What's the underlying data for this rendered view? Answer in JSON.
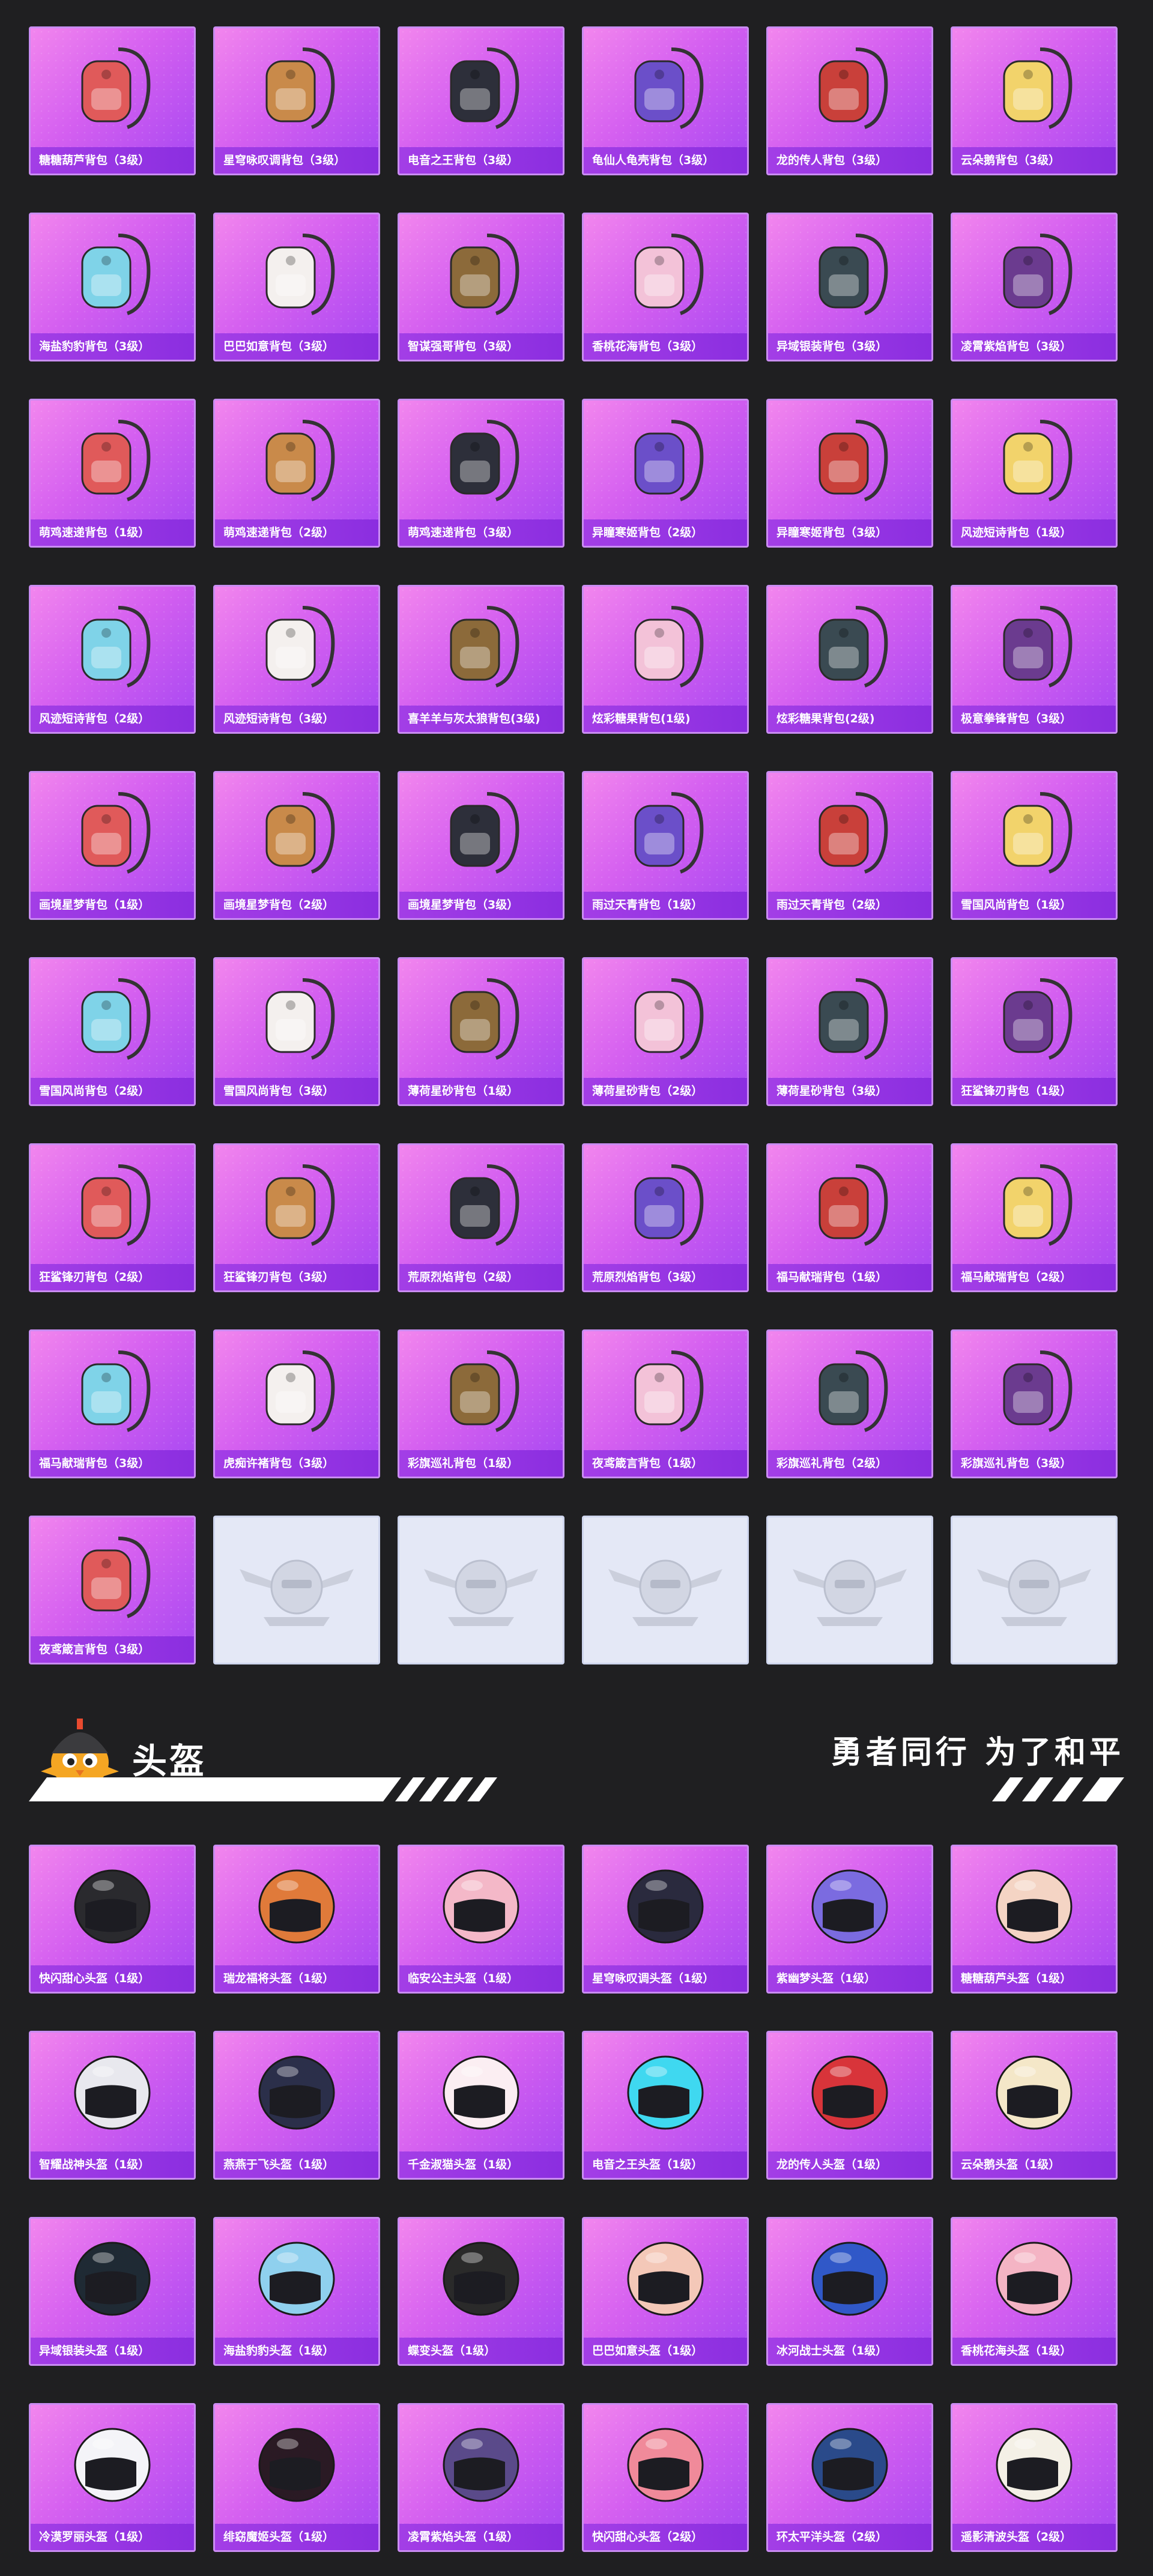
{
  "backpacks": [
    "糖糖葫芦背包（3级）",
    "星穹咏叹调背包（3级）",
    "电音之王背包（3级）",
    "龟仙人龟壳背包（3级）",
    "龙的传人背包（3级）",
    "云朵鹅背包（3级）",
    "海盐豹豹背包（3级）",
    "巴巴如意背包（3级）",
    "智谋强哥背包（3级）",
    "香桃花海背包（3级）",
    "异域银装背包（3级）",
    "凌霄紫焰背包（3级）",
    "萌鸡速递背包（1级）",
    "萌鸡速递背包（2级）",
    "萌鸡速递背包（3级）",
    "异瞳寒姬背包（2级）",
    "异瞳寒姬背包（3级）",
    "风迹短诗背包（1级）",
    "风迹短诗背包（2级）",
    "风迹短诗背包（3级）",
    "喜羊羊与灰太狼背包(3级)",
    "炫彩糖果背包(1级)",
    "炫彩糖果背包(2级)",
    "极意拳锋背包（3级）",
    "画境星梦背包（1级）",
    "画境星梦背包（2级）",
    "画境星梦背包（3级）",
    "雨过天青背包（1级）",
    "雨过天青背包（2级）",
    "雪国风尚背包（1级）",
    "雪国风尚背包（2级）",
    "雪国风尚背包（3级）",
    "薄荷星砂背包（1级）",
    "薄荷星砂背包（2级）",
    "薄荷星砂背包（3级）",
    "狂鲨锋刃背包（1级）",
    "狂鲨锋刃背包（2级）",
    "狂鲨锋刃背包（3级）",
    "荒原烈焰背包（2级）",
    "荒原烈焰背包（3级）",
    "福马献瑞背包（1级）",
    "福马献瑞背包（2级）",
    "福马献瑞背包（3级）",
    "虎痴许褚背包（3级）",
    "彩旗巡礼背包（1级）",
    "夜鸢箴言背包（1级）",
    "彩旗巡礼背包（2级）",
    "彩旗巡礼背包（3级）",
    "夜鸢箴言背包（3级）"
  ],
  "placeholder_count": 5,
  "section": {
    "title": "头盔",
    "slogan": "勇者同行 为了和平"
  },
  "helmets": [
    "快闪甜心头盔（1级）",
    "瑞龙福将头盔（1级）",
    "临安公主头盔（1级）",
    "星穹咏叹调头盔（1级）",
    "紫幽梦头盔（1级）",
    "糖糖葫芦头盔（1级）",
    "智耀战神头盔（1级）",
    "燕燕于飞头盔（1级）",
    "千金淑猫头盔（1级）",
    "电音之王头盔（1级）",
    "龙的传人头盔（1级）",
    "云朵鹅头盔（1级）",
    "异域银装头盔（1级）",
    "海盐豹豹头盔（1级）",
    "蝶变头盔（1级）",
    "巴巴如意头盔（1级）",
    "冰河战士头盔（1级）",
    "香桃花海头盔（1级）",
    "冷漠罗丽头盔（1级）",
    "绯窈魔姬头盔（1级）",
    "凌霄紫焰头盔（1级）",
    "快闪甜心头盔（2级）",
    "环太平洋头盔（2级）",
    "遥影清波头盔（2级）"
  ],
  "colors": {
    "background": "#1f1f21",
    "card_gradient_start": "#f286ee",
    "card_gradient_end": "#a547f2",
    "label_bar": "#9a36e4",
    "placeholder": "#e4e8f6"
  },
  "icons": {
    "backpack": "backpack-icon",
    "helmet": "helmet-icon",
    "placeholder": "emblem-icon",
    "mascot": "chick-helmet-mascot-icon"
  }
}
